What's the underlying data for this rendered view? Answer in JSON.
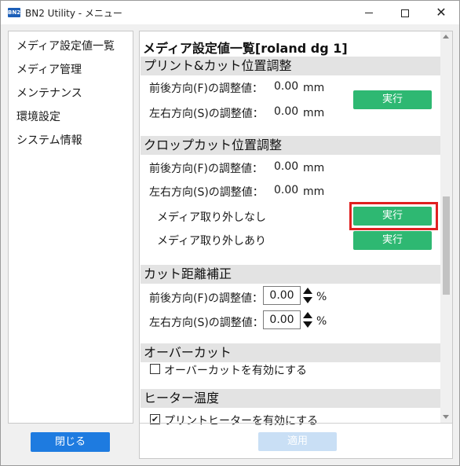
{
  "window": {
    "app_icon_text": "BN2",
    "title": "BN2 Utility - メニュー"
  },
  "sidebar": {
    "items": [
      {
        "label": "メディア設定値一覧"
      },
      {
        "label": "メディア管理"
      },
      {
        "label": "メンテナンス"
      },
      {
        "label": "環境設定"
      },
      {
        "label": "システム情報"
      }
    ]
  },
  "main": {
    "title": "メディア設定値一覧[roland dg 1]",
    "print_cut": {
      "header": "プリント&カット位置調整",
      "front_back_label": "前後方向(F)の調整値：",
      "front_back_value": "0.00",
      "left_right_label": "左右方向(S)の調整値：",
      "left_right_value": "0.00",
      "unit": "mm",
      "exec_label": "実行"
    },
    "crop_cut": {
      "header": "クロップカット位置調整",
      "front_back_label": "前後方向(F)の調整値：",
      "front_back_value": "0.00",
      "left_right_label": "左右方向(S)の調整値：",
      "left_right_value": "0.00",
      "unit": "mm",
      "no_remove_label": "メディア取り外しなし",
      "remove_label": "メディア取り外しあり",
      "exec_label": "実行"
    },
    "cut_distance": {
      "header": "カット距離補正",
      "front_back_label": "前後方向(F)の調整値：",
      "front_back_value": "0.00",
      "left_right_label": "左右方向(S)の調整値：",
      "left_right_value": "0.00",
      "unit": "%"
    },
    "overcut": {
      "header": "オーバーカット",
      "enable_label": "オーバーカットを有効にする",
      "enable_checked": false
    },
    "heater": {
      "header": "ヒーター温度",
      "print_heater_label": "プリントヒーターを有効にする",
      "print_heater_checked": true
    },
    "apply_label": "適用"
  },
  "footer": {
    "close_label": "閉じる"
  },
  "colors": {
    "exec_button": "#2eb872",
    "close_button": "#1e7be0",
    "apply_disabled": "#c9dff5",
    "highlight": "#e02020",
    "section_header_bg": "#e3e3e3"
  }
}
